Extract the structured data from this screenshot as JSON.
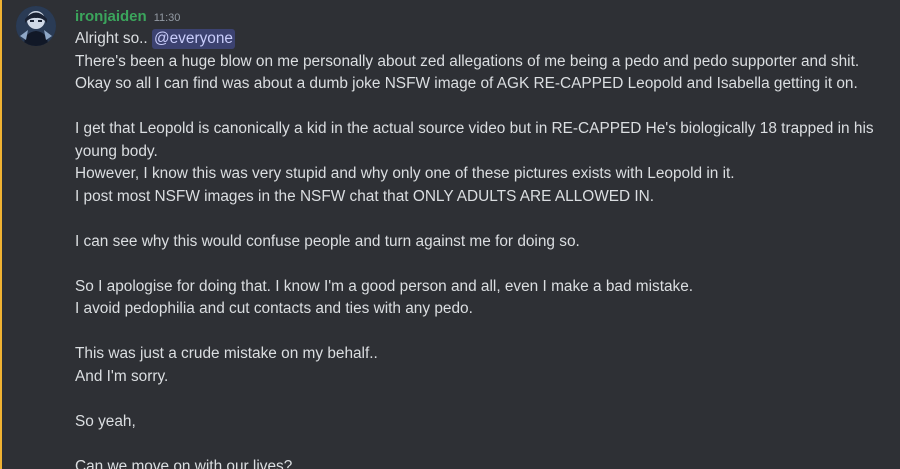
{
  "colors": {
    "accent_bar": "#f0b232",
    "username": "#3ba55c",
    "mention_bg": "#3c4270",
    "mention_text": "#c9cdfb",
    "text": "#dbdee1",
    "timestamp": "#949ba4",
    "background": "#2e3035"
  },
  "message": {
    "avatar_icon": "user-avatar-icon",
    "username": "ironjaiden",
    "timestamp": "11:30",
    "first_line_text": "Alright so..",
    "mention": "@everyone",
    "lines": [
      "There's been a huge blow on me personally about zed allegations of me being a pedo and pedo supporter and shit.",
      "Okay so all I can find was about a dumb joke NSFW image of AGK RE-CAPPED Leopold and Isabella getting it on.",
      "",
      "I get that Leopold is canonically a kid in the actual source video but in RE-CAPPED He's biologically 18 trapped in his",
      "young body.",
      "However, I know this was very stupid and why only one of these pictures exists with Leopold in it.",
      "I post most NSFW images in the NSFW chat that ONLY ADULTS ARE ALLOWED IN.",
      "",
      "I can see why this would confuse people and turn against me for doing so.",
      "",
      "So I apologise for doing that. I know I'm a good person and all, even I make a bad mistake.",
      "I avoid pedophilia and cut contacts and ties with any pedo.",
      "",
      "This was just a crude mistake on my behalf..",
      "And I'm sorry.",
      "",
      "So yeah,",
      "",
      "Can we move on with our lives?"
    ]
  }
}
